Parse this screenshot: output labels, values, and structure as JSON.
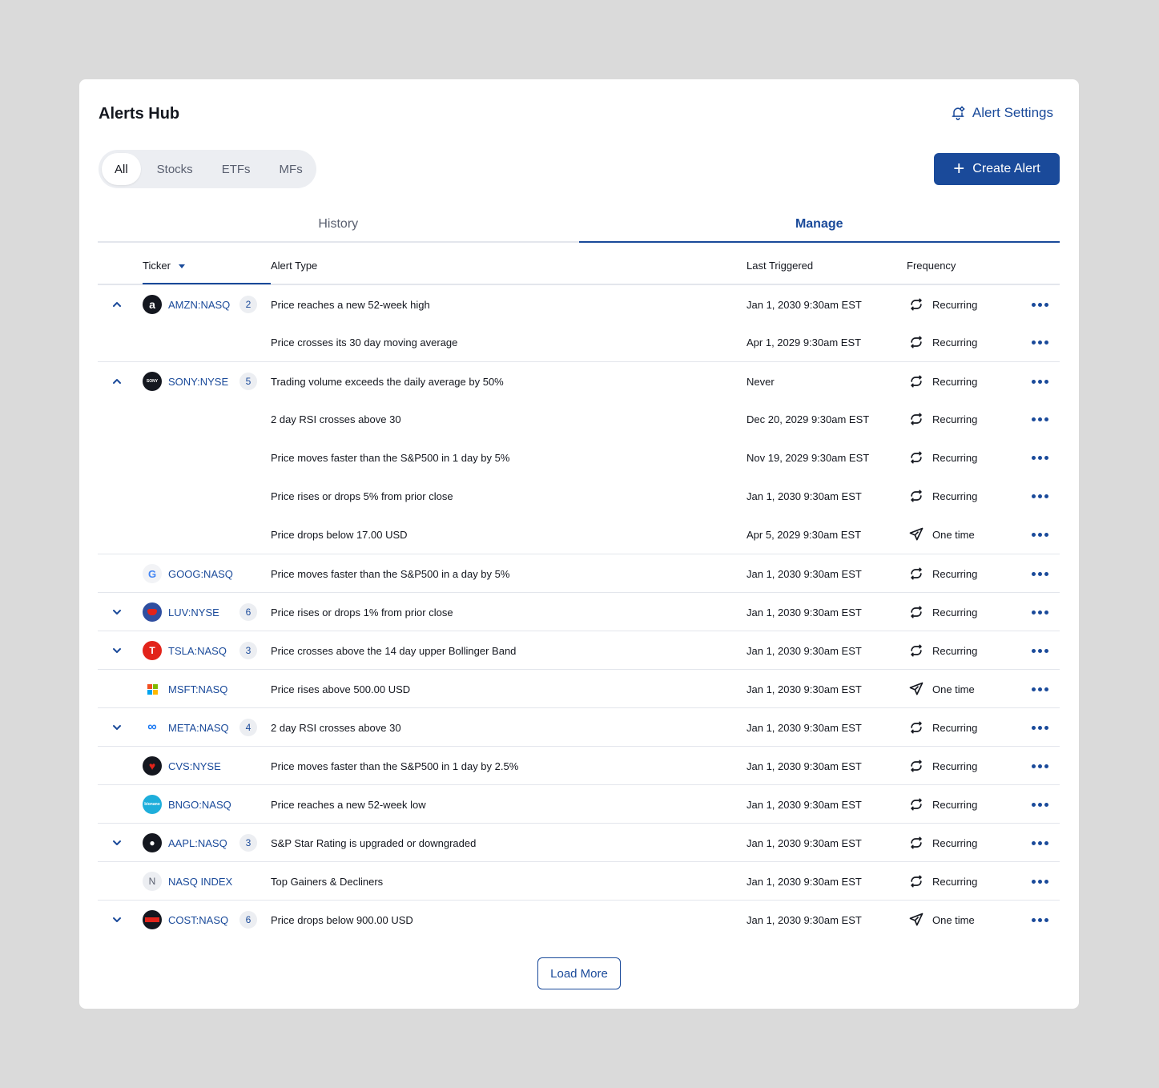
{
  "header": {
    "title": "Alerts Hub",
    "settings_label": "Alert Settings",
    "create_label": "Create Alert"
  },
  "filters": [
    "All",
    "Stocks",
    "ETFs",
    "MFs"
  ],
  "tabs": [
    "History",
    "Manage"
  ],
  "columns": {
    "ticker": "Ticker",
    "type": "Alert Type",
    "last": "Last Triggered",
    "freq": "Frequency"
  },
  "rows": [
    {
      "chevron": "up",
      "logo": "amazon",
      "ticker": "AMZN:NASQ",
      "count": "2",
      "type": "Price reaches a new 52-week high",
      "last": "Jan 1, 2030 9:30am EST",
      "freq": "Recurring"
    },
    {
      "type": "Price crosses its 30 day moving average",
      "last": "Apr 1, 2029 9:30am EST",
      "freq": "Recurring"
    },
    {
      "chevron": "up",
      "logo": "sony",
      "ticker": "SONY:NYSE",
      "count": "5",
      "type": "Trading volume exceeds the daily average by 50%",
      "last": "Never",
      "freq": "Recurring"
    },
    {
      "type": "2 day RSI crosses above 30",
      "last": "Dec 20, 2029 9:30am EST",
      "freq": "Recurring"
    },
    {
      "type": "Price moves faster than the S&P500 in 1 day by 5%",
      "last": "Nov 19, 2029 9:30am EST",
      "freq": "Recurring"
    },
    {
      "type": "Price rises or drops 5% from prior close",
      "last": "Jan 1, 2030 9:30am EST",
      "freq": "Recurring"
    },
    {
      "type": "Price drops below 17.00 USD",
      "last": "Apr 5, 2029 9:30am EST",
      "freq": "One time"
    },
    {
      "logo": "google",
      "ticker": "GOOG:NASQ",
      "type": "Price moves faster than the S&P500 in a day by 5%",
      "last": "Jan 1, 2030 9:30am EST",
      "freq": "Recurring"
    },
    {
      "chevron": "down",
      "logo": "southwest",
      "ticker": "LUV:NYSE",
      "count": "6",
      "type": "Price rises or drops 1% from prior close",
      "last": "Jan 1, 2030 9:30am EST",
      "freq": "Recurring"
    },
    {
      "chevron": "down",
      "logo": "tesla",
      "ticker": "TSLA:NASQ",
      "count": "3",
      "type": "Price crosses above the 14 day upper Bollinger Band",
      "last": "Jan 1, 2030 9:30am EST",
      "freq": "Recurring"
    },
    {
      "logo": "microsoft",
      "ticker": "MSFT:NASQ",
      "type": "Price rises above 500.00 USD",
      "last": "Jan 1, 2030 9:30am EST",
      "freq": "One time"
    },
    {
      "chevron": "down",
      "logo": "meta",
      "ticker": "META:NASQ",
      "count": "4",
      "type": "2 day RSI crosses above 30",
      "last": "Jan 1, 2030 9:30am EST",
      "freq": "Recurring"
    },
    {
      "logo": "cvs",
      "ticker": "CVS:NYSE",
      "type": "Price moves faster than the S&P500 in 1 day by 2.5%",
      "last": "Jan 1, 2030 9:30am EST",
      "freq": "Recurring"
    },
    {
      "logo": "bionano",
      "ticker": "BNGO:NASQ",
      "type": "Price reaches a new 52-week low",
      "last": "Jan 1, 2030 9:30am EST",
      "freq": "Recurring"
    },
    {
      "chevron": "down",
      "logo": "apple",
      "ticker": "AAPL:NASQ",
      "count": "3",
      "type": "S&P Star Rating is upgraded or downgraded",
      "last": "Jan 1, 2030 9:30am EST",
      "freq": "Recurring"
    },
    {
      "logo": "index",
      "logo_text": "N",
      "ticker": "NASQ INDEX",
      "type": "Top Gainers & Decliners",
      "last": "Jan 1, 2030 9:30am EST",
      "freq": "Recurring"
    },
    {
      "chevron": "down",
      "logo": "costco",
      "ticker": "COST:NASQ",
      "count": "6",
      "type": "Price drops below 900.00 USD",
      "last": "Jan 1, 2030 9:30am EST",
      "freq": "One time"
    }
  ],
  "load_more": "Load More",
  "colors": {
    "accent": "#1a4a9a",
    "border": "#e3e6ec",
    "page_bg": "#dadada"
  }
}
